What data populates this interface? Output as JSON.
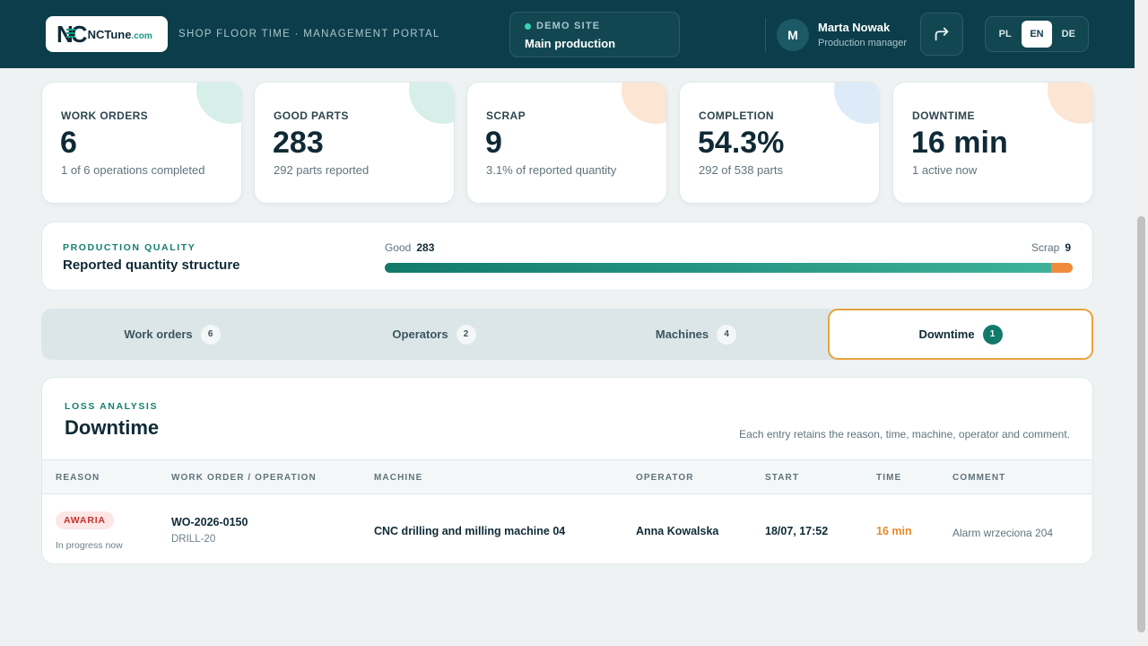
{
  "header": {
    "logo_mark": "NC",
    "logo_name": "NCTune",
    "logo_domain": ".com",
    "portal_title": "SHOP FLOOR TIME · MANAGEMENT PORTAL",
    "site_label": "DEMO SITE",
    "site_name": "Main production",
    "user": {
      "initial": "M",
      "name": "Marta Nowak",
      "role": "Production manager"
    },
    "languages": [
      {
        "code": "PL",
        "active": false
      },
      {
        "code": "EN",
        "active": true
      },
      {
        "code": "DE",
        "active": false
      }
    ]
  },
  "kpis": [
    {
      "label": "WORK ORDERS",
      "value": "6",
      "sub": "1 of 6 operations completed",
      "accent": "#d7efe9"
    },
    {
      "label": "GOOD PARTS",
      "value": "283",
      "sub": "292 parts reported",
      "accent": "#d7efe9"
    },
    {
      "label": "SCRAP",
      "value": "9",
      "sub": "3.1% of reported quantity",
      "accent": "#fde5d3"
    },
    {
      "label": "COMPLETION",
      "value": "54.3%",
      "sub": "292 of 538 parts",
      "accent": "#dcebf7"
    },
    {
      "label": "DOWNTIME",
      "value": "16 min",
      "sub": "1 active now",
      "accent": "#fde5d3"
    }
  ],
  "quality": {
    "eyebrow": "PRODUCTION QUALITY",
    "title": "Reported quantity structure",
    "good_label": "Good",
    "good_value": "283",
    "scrap_label": "Scrap",
    "scrap_value": "9",
    "good_fraction": 0.969
  },
  "tabs": [
    {
      "label": "Work orders",
      "count": "6",
      "active": false
    },
    {
      "label": "Operators",
      "count": "2",
      "active": false
    },
    {
      "label": "Machines",
      "count": "4",
      "active": false
    },
    {
      "label": "Downtime",
      "count": "1",
      "active": true
    }
  ],
  "downtime": {
    "eyebrow": "LOSS ANALYSIS",
    "title": "Downtime",
    "note": "Each entry retains the reason, time, machine, operator and comment.",
    "columns": [
      "REASON",
      "WORK ORDER / OPERATION",
      "MACHINE",
      "OPERATOR",
      "START",
      "TIME",
      "COMMENT"
    ],
    "rows": [
      {
        "reason": "AWARIA",
        "status": "In progress now",
        "work_order": "WO-2026-0150",
        "operation": "DRILL-20",
        "machine": "CNC drilling and milling machine 04",
        "operator": "Anna Kowalska",
        "start": "18/07, 17:52",
        "time": "16 min",
        "comment": "Alarm wrzeciona 204"
      }
    ]
  },
  "colors": {
    "header_bg": "#0c3d4a",
    "accent_teal": "#127a6a",
    "accent_orange": "#e88a2d",
    "active_tab_border": "#e8a33c",
    "danger": "#c9302c"
  }
}
